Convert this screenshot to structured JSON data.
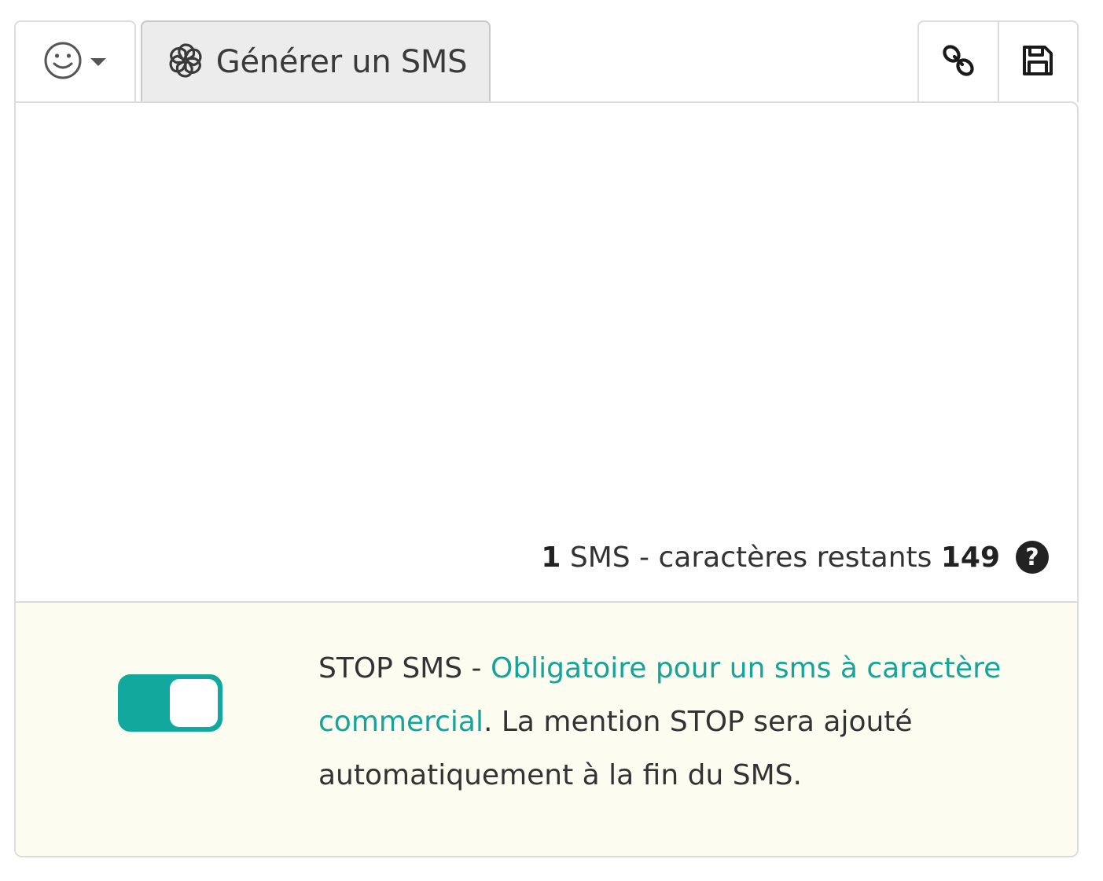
{
  "toolbar": {
    "emoji_button": {
      "icon": "smiley-icon",
      "caret": "chevron-down-icon"
    },
    "generate_button": {
      "icon": "openai-logo-icon",
      "label": "Générer un SMS"
    },
    "link_button": {
      "icon": "link-icon"
    },
    "save_button": {
      "icon": "floppy-disk-icon"
    }
  },
  "editor": {
    "message_value": "",
    "counter": {
      "sms_count": "1",
      "sms_label": "SMS - caractères restants",
      "remaining": "149",
      "help_icon": "question-circle-icon",
      "help_glyph": "?"
    }
  },
  "stop_sms": {
    "enabled": true,
    "prefix": "STOP SMS - ",
    "link_text": "Obligatoire pour un sms à caractère commercial",
    "suffix": ". La mention STOP sera ajouté automatiquement à la fin du SMS."
  },
  "colors": {
    "accent": "#12a89e",
    "link": "#15a49a",
    "notice_background": "#fcfdf0",
    "border": "#dcdcdc"
  }
}
